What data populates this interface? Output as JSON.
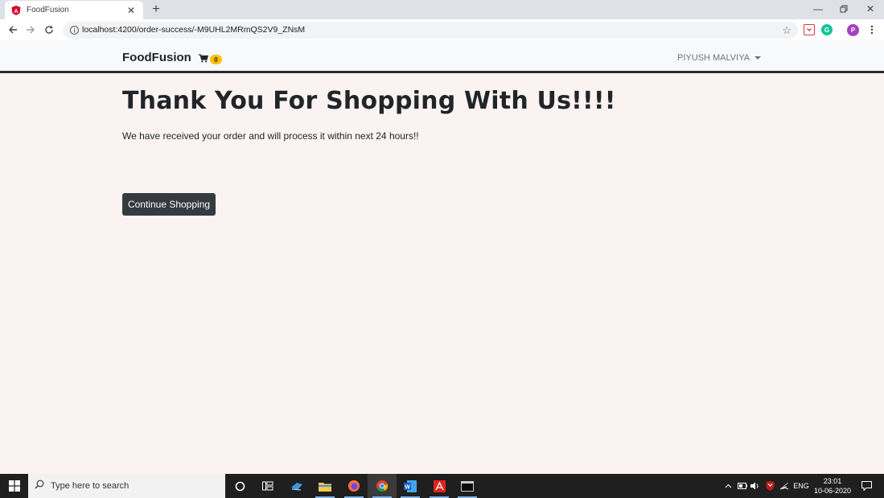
{
  "browser": {
    "tab_title": "FoodFusion",
    "url": "localhost:4200/order-success/-M9UHL2MRmQS2V9_ZNsM",
    "profile_initial": "P",
    "icons": {
      "favicon": "angular-icon",
      "new_tab": "plus-icon",
      "back": "back-arrow-icon",
      "forward": "forward-arrow-icon",
      "reload": "reload-icon",
      "info": "info-icon",
      "bookmark": "star-icon",
      "menu": "kebab-menu-icon"
    }
  },
  "navbar": {
    "brand": "FoodFusion",
    "cart_count": "0",
    "user_name": "PIYUSH MALVIYA"
  },
  "main": {
    "headline": "Thank You For Shopping With Us!!!!",
    "message": "We have received your order and will process it within next 24 hours!!",
    "continue_label": "Continue Shopping"
  },
  "taskbar": {
    "search_placeholder": "Type here to search",
    "language": "ENG",
    "time": "23:01",
    "date": "10-06-2020"
  },
  "colors": {
    "page_bg": "#faf3f2",
    "button_bg": "#343a40",
    "badge_bg": "#ffc107",
    "navbar_border": "#2b2b2b"
  }
}
